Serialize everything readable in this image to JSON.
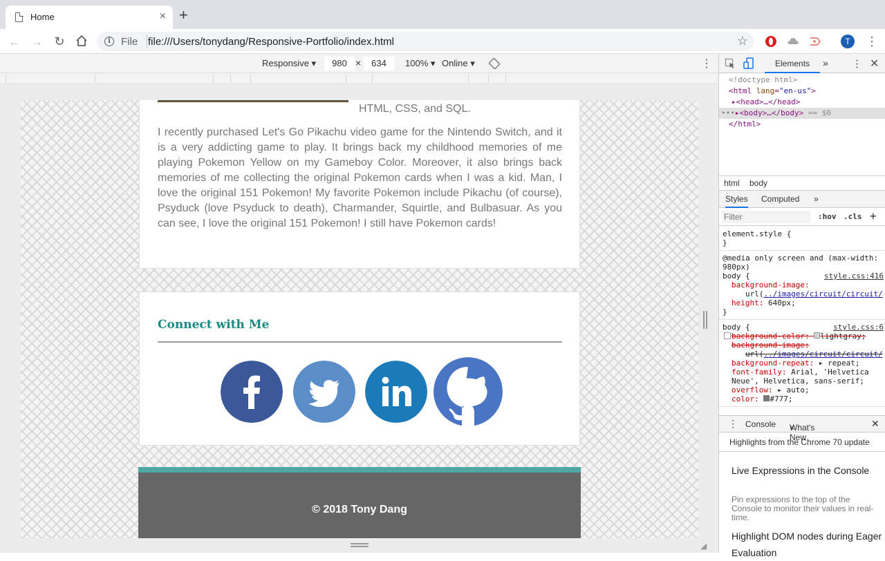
{
  "browser": {
    "tab_title": "Home",
    "tab_close": "×",
    "new_tab": "+",
    "scheme": "File",
    "url": "file:///Users/tonydang/Responsive-Portfolio/index.html",
    "avatar_letter": "T"
  },
  "device_toolbar": {
    "mode": "Responsive ▾",
    "width": "980",
    "times": "×",
    "height": "634",
    "zoom": "100% ▾",
    "network": "Online ▾"
  },
  "page": {
    "skills_fragment": "HTML, CSS, and SQL.",
    "bio": "I recently purchased Let's Go Pikachu video game for the Nintendo Switch, and it is a very addicting game to play. It brings back my childhood memories of me playing Pokemon Yellow on my Gameboy Color. Moreover, it also brings back memories of me collecting the original Pokemon cards when I was a kid. Man, I love the original 151 Pokemon! My favorite Pokemon include Pikachu (of course), Psyduck (love Psyduck to death), Charmander, Squirtle, and Bulbasuar. As you can see, I love the original 151 Pokemon! I still have Pokemon cards!",
    "connect_title": "Connect with Me",
    "social": [
      {
        "name": "facebook",
        "color": "#3b5998"
      },
      {
        "name": "twitter",
        "color": "#5b8dc9"
      },
      {
        "name": "linkedin",
        "color": "#1b7ab8"
      },
      {
        "name": "github",
        "color": "#4a74c4"
      }
    ],
    "footer_text": "© 2018 Tony Dang",
    "footer_accent": "#4ea8a0"
  },
  "devtools": {
    "tab_elements": "Elements",
    "more": "»",
    "dom": {
      "doctype": "<!doctype html>",
      "html_open_tag": "<html",
      "html_attr": "lang",
      "html_attr_val": "\"en-us\"",
      "head": "▸<head>…</head>",
      "body": "▸<body>…</body>",
      "body_marker": "== $0",
      "html_close": "</html>"
    },
    "crumbs": [
      "html",
      "body"
    ],
    "subtabs": [
      "Styles",
      "Computed",
      "»"
    ],
    "filter_placeholder": "Filter",
    "hov": ":hov",
    "cls": ".cls",
    "plus": "+",
    "styles": {
      "element_style": "element.style {",
      "close": "}",
      "media": "@media only screen and (max-width: 980px)",
      "body_sel": "body {",
      "src1": "style.css:416",
      "bg_image": "background-image:",
      "url_prefix": "url(",
      "url_link": "../images/circuit/circuit/",
      "height_prop": "height:",
      "height_val": "640px;",
      "src2": "style.css:6",
      "bg_color": "background-color:",
      "bg_color_val": "lightgray;",
      "bg_repeat": "background-repeat:",
      "bg_repeat_val": "▸ repeat;",
      "font_family": "font-family:",
      "font_family_val": "Arial, 'Helvetica Neue', Helvetica, sans-serif;",
      "overflow": "overflow:",
      "overflow_val": "▸ auto;",
      "color": "color:",
      "color_val": "#777;"
    },
    "drawer": {
      "console": "Console",
      "whats_new": "What's New",
      "close": "×",
      "highlights": "Highlights from the Chrome 70 update",
      "item1_title": "Live Expressions in the Console",
      "item1_desc": "Pin expressions to the top of the Console to monitor their values in real-time.",
      "item2_title": "Highlight DOM nodes during Eager Evaluation"
    }
  }
}
